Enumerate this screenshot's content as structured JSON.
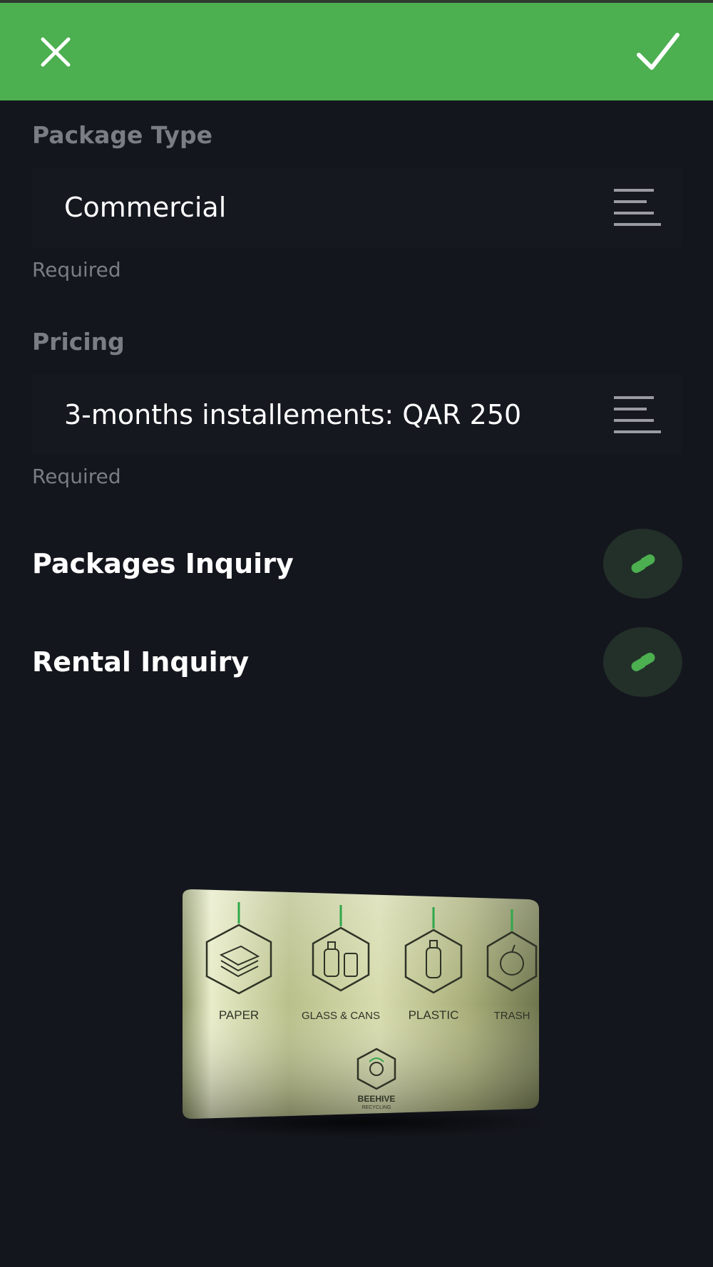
{
  "header": {
    "close_icon": "close-icon",
    "confirm_icon": "check-icon",
    "background_color": "#4caf50"
  },
  "package_type": {
    "label": "Package Type",
    "value": "Commercial",
    "helper": "Required",
    "menu_icon": "menu-lines-icon"
  },
  "pricing": {
    "label": "Pricing",
    "value": "3-months installements: QAR 250",
    "helper": "Required",
    "menu_icon": "menu-lines-icon"
  },
  "inquiries": [
    {
      "label": "Packages Inquiry",
      "icon": "link-icon"
    },
    {
      "label": "Rental Inquiry",
      "icon": "link-icon"
    }
  ],
  "product_image": {
    "compartments": [
      "PAPER",
      "GLASS & CANS",
      "PLASTIC",
      "TRASH"
    ],
    "brand": "BEEHIVE",
    "brand_sub": "RECYCLING"
  }
}
